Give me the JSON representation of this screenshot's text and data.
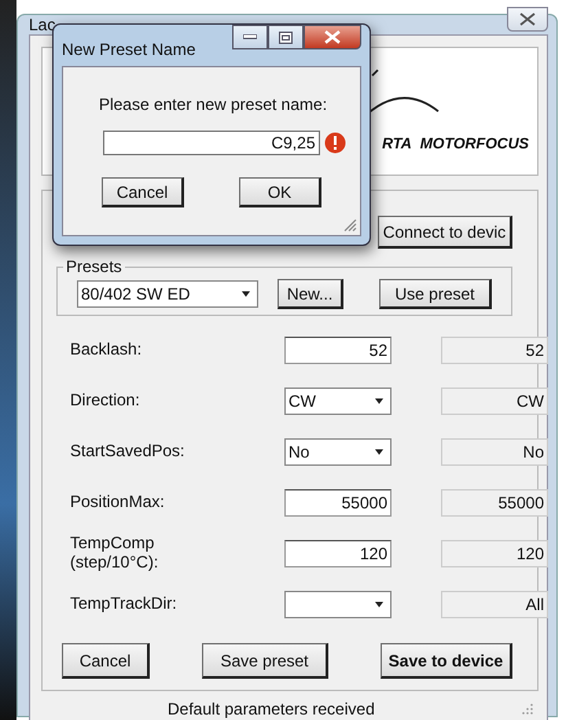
{
  "main_window": {
    "title": "Lac"
  },
  "logo": {
    "texts": [
      "RTA",
      "MOTORFOCUS"
    ]
  },
  "connect_button": "Connect to devic",
  "presets": {
    "label": "Presets",
    "dropdown": "80/402 SW ED",
    "new_button": "New...",
    "use_button": "Use preset"
  },
  "params": [
    {
      "label": "Backlash:",
      "kind": "input",
      "value": "52",
      "device_value": "52"
    },
    {
      "label": "Direction:",
      "kind": "dropdown",
      "value": "CW",
      "device_value": "CW"
    },
    {
      "label": "StartSavedPos:",
      "kind": "dropdown",
      "value": "No",
      "device_value": "No"
    },
    {
      "label": "PositionMax:",
      "kind": "input",
      "value": "55000",
      "device_value": "55000"
    },
    {
      "label": "TempComp\n(step/10°C):",
      "kind": "input",
      "value": "120",
      "device_value": "120"
    },
    {
      "label": "TempTrackDir:",
      "kind": "dropdown",
      "device_value": "All"
    }
  ],
  "buttons": [
    {
      "label": "Cancel",
      "kind": "normal"
    },
    {
      "label": "Save preset",
      "kind": "normal"
    },
    {
      "label": "Save to device",
      "kind": "default"
    }
  ],
  "status_bar": "Default parameters received",
  "dialog": {
    "title": "New Preset Name",
    "prompt": "Please enter new preset name:",
    "value": "C9,25",
    "error": true,
    "buttons": [
      "Cancel",
      "OK"
    ]
  }
}
